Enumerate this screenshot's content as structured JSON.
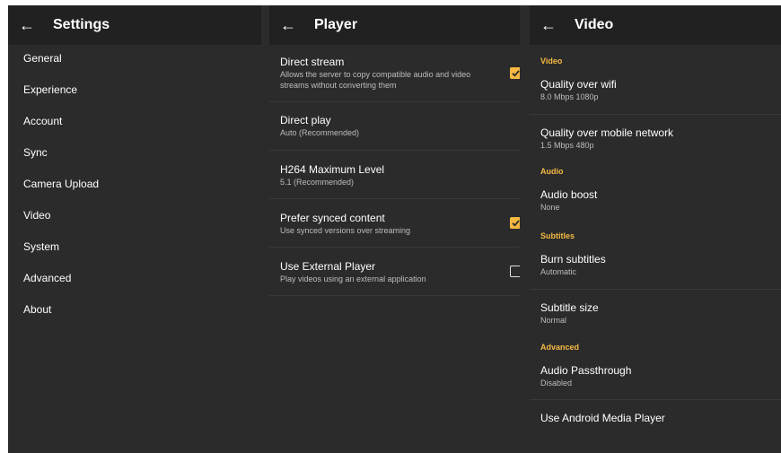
{
  "settings": {
    "title": "Settings",
    "items": [
      "General",
      "Experience",
      "Account",
      "Sync",
      "Camera Upload",
      "Video",
      "System",
      "Advanced",
      "About"
    ]
  },
  "player": {
    "title": "Player",
    "rows": [
      {
        "title": "Direct stream",
        "subtitle": "Allows the server to copy compatible audio and video streams without converting them",
        "checked": true
      },
      {
        "title": "Direct play",
        "subtitle": "Auto (Recommended)"
      },
      {
        "title": "H264 Maximum Level",
        "subtitle": "5.1 (Recommended)"
      },
      {
        "title": "Prefer synced content",
        "subtitle": "Use synced versions over streaming",
        "checked": true
      },
      {
        "title": "Use External Player",
        "subtitle": "Play videos using an external application",
        "checked": false
      }
    ]
  },
  "video": {
    "title": "Video",
    "sections": {
      "video": "Video",
      "audio": "Audio",
      "subtitles": "Subtitles",
      "advanced": "Advanced"
    },
    "quality_wifi": {
      "title": "Quality over wifi",
      "subtitle": "8.0 Mbps 1080p"
    },
    "quality_mobile": {
      "title": "Quality over mobile network",
      "subtitle": "1.5 Mbps 480p"
    },
    "audio_boost": {
      "title": "Audio boost",
      "subtitle": "None"
    },
    "burn_subtitles": {
      "title": "Burn subtitles",
      "subtitle": "Automatic"
    },
    "subtitle_size": {
      "title": "Subtitle size",
      "subtitle": "Normal"
    },
    "audio_passthrough": {
      "title": "Audio Passthrough",
      "subtitle": "Disabled"
    },
    "android_player": {
      "title": "Use Android Media Player"
    }
  },
  "colors": {
    "accent": "#f5b942",
    "header": "#212121",
    "background": "#2b2b2b"
  },
  "icons": {
    "back": "arrow-left-icon",
    "checked": "checkbox-checked-icon",
    "unchecked": "checkbox-unchecked-icon"
  }
}
